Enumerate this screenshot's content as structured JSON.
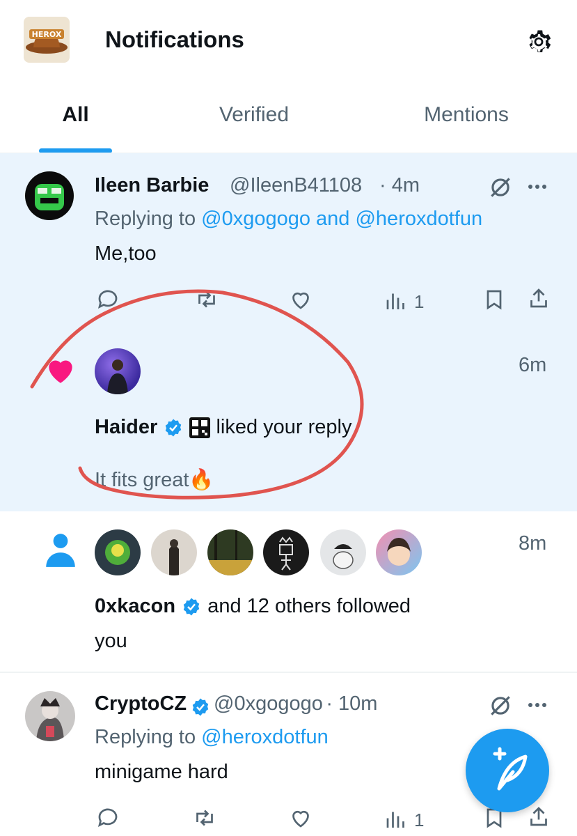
{
  "header": {
    "logo_text": "HEROX",
    "title": "Notifications",
    "settings_icon": "gear-icon"
  },
  "tabs": [
    {
      "label": "All",
      "active": true
    },
    {
      "label": "Verified",
      "active": false
    },
    {
      "label": "Mentions",
      "active": false
    }
  ],
  "notifications": [
    {
      "kind": "reply",
      "name": "Ileen Barbie",
      "handle": "@IleenB41108",
      "time": "· 4m",
      "replying_prefix": "Replying to",
      "replying_to": "@0xgogogo and @heroxdotfun",
      "body": "Me,too",
      "views": "1"
    },
    {
      "kind": "like",
      "name": "Haider",
      "action": "liked your reply",
      "time": "6m",
      "quoted": "It fits great🔥"
    },
    {
      "kind": "follow",
      "name": "0xkacon",
      "action_line1": "and 12 others followed",
      "action_line2": "you",
      "time": "8m"
    },
    {
      "kind": "reply",
      "name": "CryptoCZ",
      "handle": "@0xgogogo",
      "time": "· 10m",
      "replying_prefix": "Replying to",
      "replying_to": "@heroxdotfun",
      "body": "minigame hard",
      "views": "1"
    }
  ],
  "colors": {
    "accent": "#1d9bf0",
    "highlight_bg": "#eaf4fd",
    "like_pink": "#f91880",
    "annotation_red": "#e0544f"
  }
}
